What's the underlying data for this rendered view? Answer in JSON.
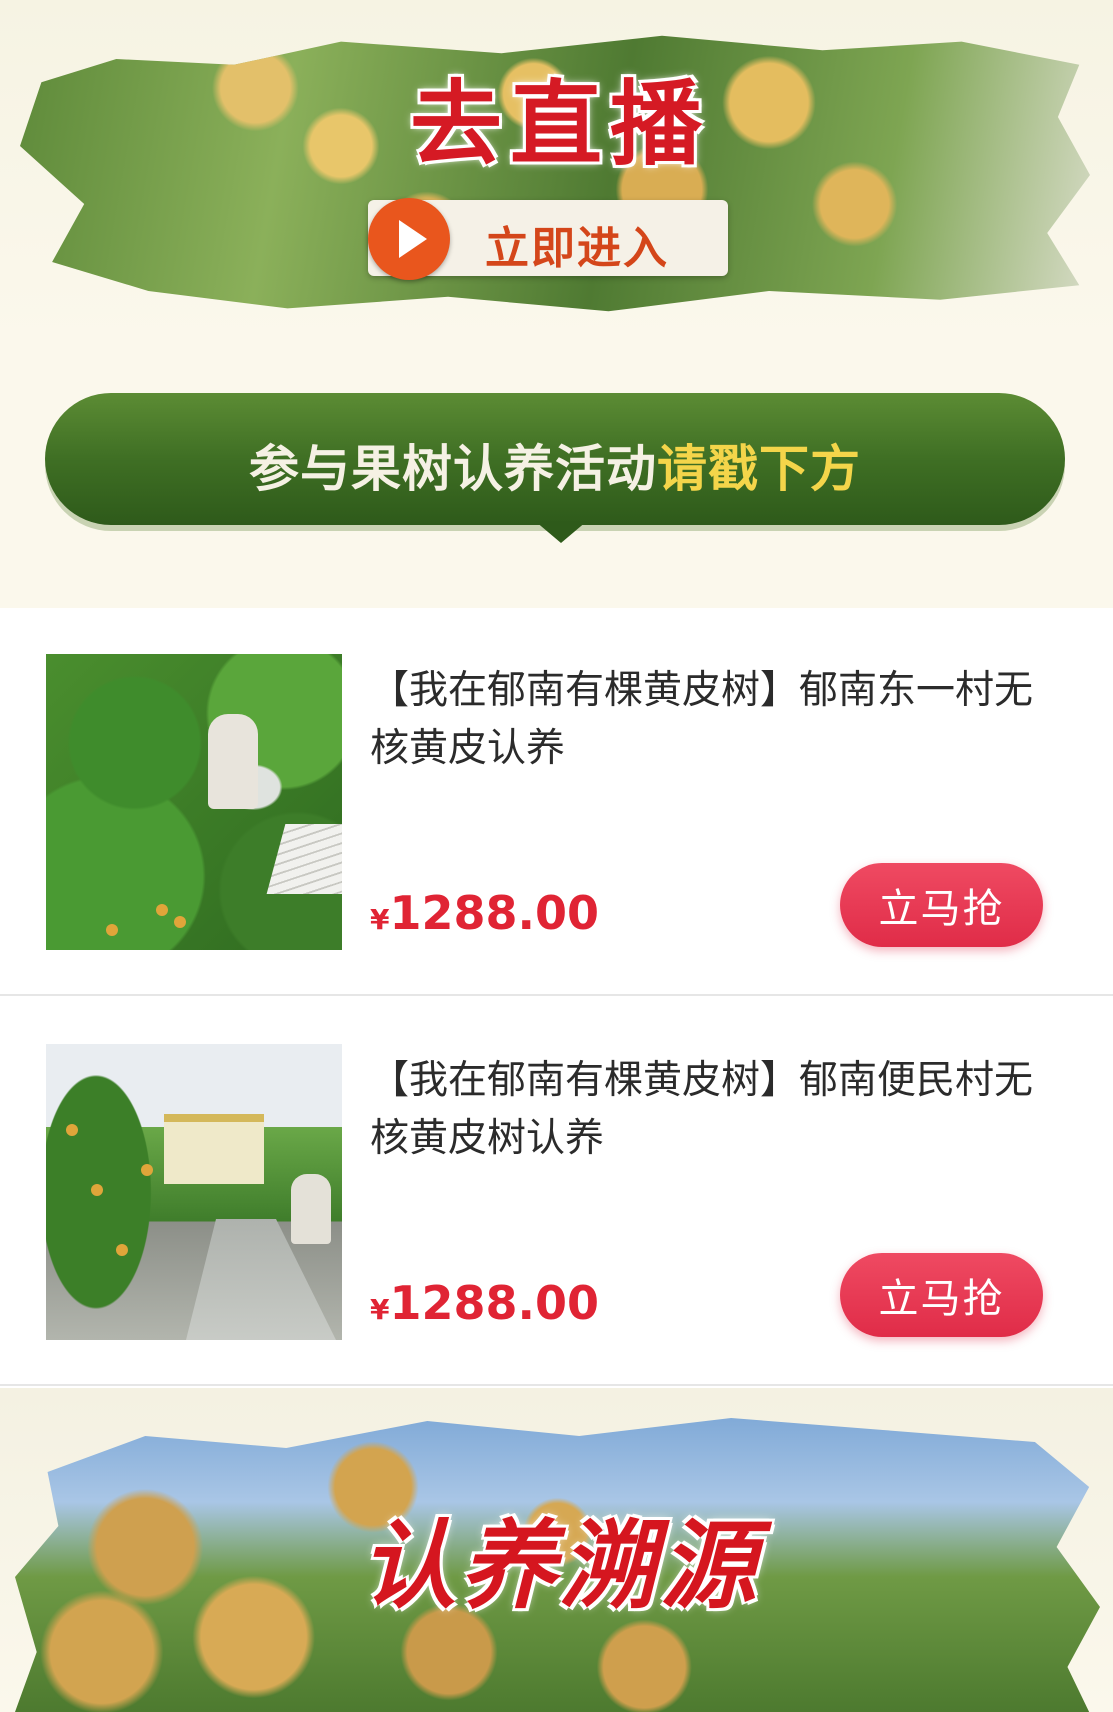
{
  "live_banner": {
    "title": "去直播",
    "enter_label": "立即进入"
  },
  "activity_ribbon": {
    "text_main": "参与果树认养活动",
    "text_highlight": "请戳下方"
  },
  "products": [
    {
      "title": "【我在郁南有棵黄皮树】郁南东一村无核黄皮认养",
      "currency": "¥",
      "price": "1288.00",
      "buy_label": "立马抢"
    },
    {
      "title": "【我在郁南有棵黄皮树】郁南便民村无核黄皮树认养",
      "currency": "¥",
      "price": "1288.00",
      "buy_label": "立马抢"
    }
  ],
  "trace_banner": {
    "title": "认养溯源"
  },
  "colors": {
    "accent_red": "#e02434",
    "button_red": "#e02c48",
    "ribbon_green": "#3f6f24",
    "highlight_gold": "#f4d54a",
    "play_orange": "#e9561d"
  },
  "icons": {
    "play": "play-icon"
  }
}
